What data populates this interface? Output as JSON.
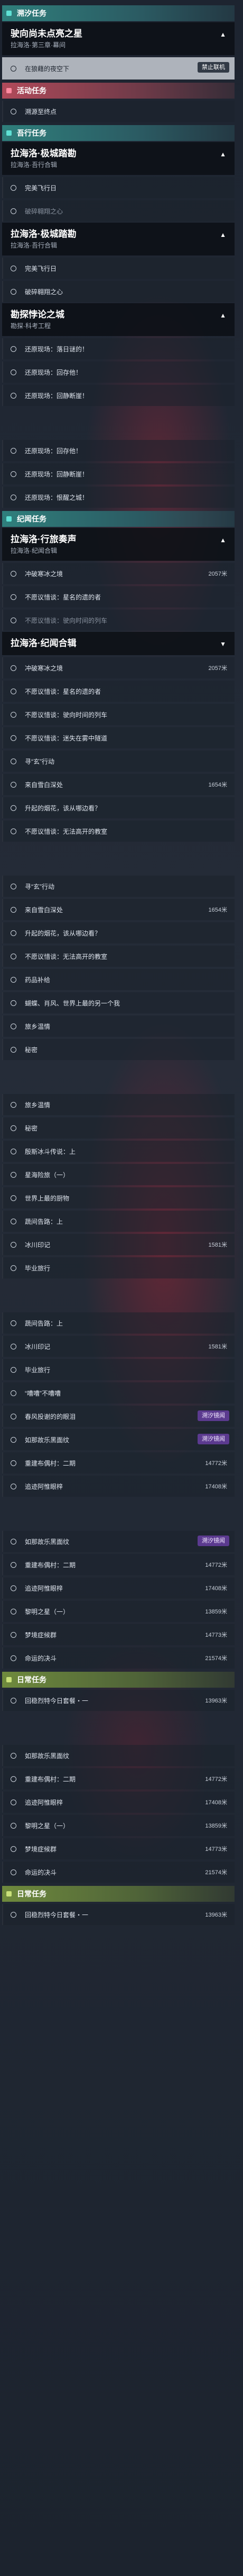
{
  "sections": [
    {
      "type": "section",
      "color": "teal",
      "label": "溯汐任务"
    },
    {
      "type": "chapter",
      "title": "驶向尚未点亮之星",
      "subtitle": "拉海洛·第三章·幕间",
      "expanded": true
    },
    {
      "type": "row",
      "label": "在狼藉的夜空下",
      "status": "active",
      "badge": "禁止联机"
    },
    {
      "type": "section",
      "color": "pink",
      "label": "活动任务"
    },
    {
      "type": "row",
      "label": "溯源至终点",
      "status": "open"
    },
    {
      "type": "section",
      "color": "teal",
      "label": "吾行任务"
    },
    {
      "type": "chapter",
      "title": "拉海洛·极城踏勘",
      "subtitle": "拉海洛·吾行合辑",
      "expanded": true
    },
    {
      "type": "row",
      "label": "完美飞行日",
      "status": "open"
    },
    {
      "type": "row",
      "label": "破碎翱翔之心",
      "status": "dim"
    },
    {
      "type": "chapter",
      "title": "拉海洛·极城踏勘",
      "subtitle": "拉海洛·吾行合辑",
      "expanded": true
    },
    {
      "type": "row",
      "label": "完美飞行日",
      "status": "open"
    },
    {
      "type": "row",
      "label": "破碎翱翔之心",
      "status": "open"
    },
    {
      "type": "chapter",
      "title": "勘探悖论之城",
      "subtitle": "勘探·科考工程",
      "expanded": true
    },
    {
      "type": "row",
      "label": "还原现场：落日谜的！",
      "status": "open"
    },
    {
      "type": "row",
      "label": "还原现场：回存他！",
      "status": "open"
    },
    {
      "type": "row",
      "label": "还原现场：回静断崖！",
      "status": "open"
    },
    {
      "type": "gap"
    },
    {
      "type": "row",
      "label": "还原现场：回存他！",
      "status": "open"
    },
    {
      "type": "row",
      "label": "还原现场：回静断崖！",
      "status": "open"
    },
    {
      "type": "row",
      "label": "还原现场：恨醒之城！",
      "status": "open"
    },
    {
      "type": "section",
      "color": "teal",
      "label": "纪闻任务"
    },
    {
      "type": "chapter",
      "title": "拉海洛·行旅奏声",
      "subtitle": "拉海洛·纪闻合辑",
      "expanded": true
    },
    {
      "type": "row",
      "label": "冲破寒冰之境",
      "status": "open",
      "dist": "2057米"
    },
    {
      "type": "row",
      "label": "不愿议惜谈：星名的遗的者",
      "status": "open"
    },
    {
      "type": "row",
      "label": "不愿议惜谈：驶向时间的列车",
      "status": "dim"
    },
    {
      "type": "chapter",
      "title": "拉海洛·纪闻合辑",
      "subtitle": "",
      "expanded": false
    },
    {
      "type": "row",
      "label": "冲破寒冰之境",
      "status": "open",
      "dist": "2057米"
    },
    {
      "type": "row",
      "label": "不愿议惜谈：星名的遗的者",
      "status": "open"
    },
    {
      "type": "row",
      "label": "不愿议惜谈：驶向时间的列车",
      "status": "open"
    },
    {
      "type": "row",
      "label": "不愿议惜谈：迷失在雾中隧道",
      "status": "open"
    },
    {
      "type": "row",
      "label": "寻“玄”行动",
      "status": "open"
    },
    {
      "type": "row",
      "label": "来自雪白深处",
      "status": "open",
      "dist": "1654米"
    },
    {
      "type": "row",
      "label": "升起的烟花，该从哪边看？",
      "status": "open"
    },
    {
      "type": "row",
      "label": "不愿议惜谈：无法高开的教室",
      "status": "open"
    },
    {
      "type": "gap"
    },
    {
      "type": "row",
      "label": "寻“玄”行动",
      "status": "open"
    },
    {
      "type": "row",
      "label": "来自雪白深处",
      "status": "open",
      "dist": "1654米"
    },
    {
      "type": "row",
      "label": "升起的烟花，该从哪边看？",
      "status": "open"
    },
    {
      "type": "row",
      "label": "不愿议惜谈：无法高开的教室",
      "status": "open"
    },
    {
      "type": "row",
      "label": "药品补给",
      "status": "open"
    },
    {
      "type": "row",
      "label": "蝴蝶、肖风、世界上最的另一个我",
      "status": "open"
    },
    {
      "type": "row",
      "label": "旅乡温情",
      "status": "open"
    },
    {
      "type": "row",
      "label": "秘密",
      "status": "open"
    },
    {
      "type": "gap"
    },
    {
      "type": "row",
      "label": "旅乡温情",
      "status": "open"
    },
    {
      "type": "row",
      "label": "秘密",
      "status": "open"
    },
    {
      "type": "row",
      "label": "殷斯冰斗传说：上",
      "status": "open"
    },
    {
      "type": "row",
      "label": "星海险旅（一）",
      "status": "open"
    },
    {
      "type": "row",
      "label": "世界上最的厨物",
      "status": "open"
    },
    {
      "type": "row",
      "label": "蔬间告路：上",
      "status": "open"
    },
    {
      "type": "row",
      "label": "冰川印记",
      "status": "open",
      "dist": "1581米"
    },
    {
      "type": "row",
      "label": "毕业旅行",
      "status": "open"
    },
    {
      "type": "gap"
    },
    {
      "type": "row",
      "label": "蔬间告路：上",
      "status": "open"
    },
    {
      "type": "row",
      "label": "冰川印记",
      "status": "open",
      "dist": "1581米"
    },
    {
      "type": "row",
      "label": "毕业旅行",
      "status": "open"
    },
    {
      "type": "row",
      "label": "“嘈嘈”不嘈嘈",
      "status": "open"
    },
    {
      "type": "row",
      "label": "春风投谢的的眼泪",
      "status": "open",
      "badge": "溯汐镜闻"
    },
    {
      "type": "row",
      "label": "如那故乐黑面纹",
      "status": "open",
      "badge": "溯汐镜闻"
    },
    {
      "type": "row",
      "label": "重建布偶村：二期",
      "status": "open",
      "dist": "14772米"
    },
    {
      "type": "row",
      "label": "追迹阿惟眼梓",
      "status": "open",
      "dist": "17408米"
    },
    {
      "type": "gap"
    },
    {
      "type": "row",
      "label": "如那故乐黑面纹",
      "status": "open",
      "badge": "溯汐镜闻"
    },
    {
      "type": "row",
      "label": "重建布偶村：二期",
      "status": "open",
      "dist": "14772米"
    },
    {
      "type": "row",
      "label": "追迹阿惟眼梓",
      "status": "open",
      "dist": "17408米"
    },
    {
      "type": "row",
      "label": "黎明之星（一）",
      "status": "open",
      "dist": "13859米"
    },
    {
      "type": "row",
      "label": "梦境症候群",
      "status": "open",
      "dist": "14773米"
    },
    {
      "type": "row",
      "label": "命运的决斗",
      "status": "open",
      "dist": "21574米"
    },
    {
      "type": "section",
      "color": "olive",
      "label": "日常任务"
    },
    {
      "type": "row",
      "label": "回稳烈特今日套餐・一",
      "status": "open",
      "dist": "13963米"
    },
    {
      "type": "gap"
    },
    {
      "type": "row",
      "label": "如那故乐黑面纹",
      "status": "open"
    },
    {
      "type": "row",
      "label": "重建布偶村：二期",
      "status": "open",
      "dist": "14772米"
    },
    {
      "type": "row",
      "label": "追迹阿惟眼梓",
      "status": "open",
      "dist": "17408米"
    },
    {
      "type": "row",
      "label": "黎明之星（一）",
      "status": "open",
      "dist": "13859米"
    },
    {
      "type": "row",
      "label": "梦境症候群",
      "status": "open",
      "dist": "14773米"
    },
    {
      "type": "row",
      "label": "命运的决斗",
      "status": "open",
      "dist": "21574米"
    },
    {
      "type": "section",
      "color": "olive",
      "label": "日常任务"
    },
    {
      "type": "row",
      "label": "回稳烈特今日套餐・一",
      "status": "open",
      "dist": "13963米"
    }
  ]
}
